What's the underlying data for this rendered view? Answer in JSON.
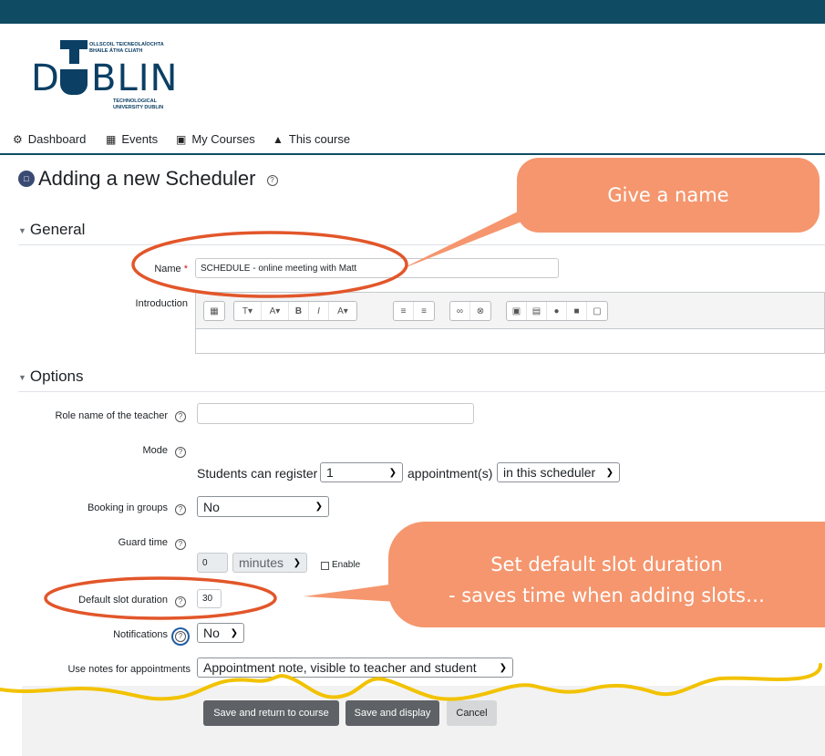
{
  "logo": {
    "irish": "OLLSCOIL TEICNEOLAÍOCHTA\nBHAILE ÁTHA CLIATH",
    "word_d": "D",
    "word_rest": "BLIN",
    "english": "TECHNOLOGICAL\nUNIVERSITY DUBLIN"
  },
  "nav": [
    {
      "label": "Dashboard",
      "icon": "dashboard-icon"
    },
    {
      "label": "Events",
      "icon": "calendar-icon"
    },
    {
      "label": "My Courses",
      "icon": "briefcase-icon"
    },
    {
      "label": "This course",
      "icon": "sitemap-icon"
    }
  ],
  "page": {
    "title": "Adding a new Scheduler"
  },
  "sections": {
    "general": "General",
    "options": "Options"
  },
  "form": {
    "name_label": "Name",
    "required_mark": "*",
    "name_value": "SCHEDULE - online meeting with Matt",
    "intro_label": "Introduction",
    "teacher_label": "Role name of the teacher",
    "teacher_value": "",
    "mode_label": "Mode",
    "mode_prefix": "Students can register",
    "mode_count": "1",
    "mode_mid": "appointment(s)",
    "mode_scope": "in this scheduler",
    "groups_label": "Booking in groups",
    "groups_value": "No",
    "guard_label": "Guard time",
    "guard_value": "0",
    "guard_unit": "minutes",
    "guard_enable": "Enable",
    "duration_label": "Default slot duration",
    "duration_value": "30",
    "notif_label": "Notifications",
    "notif_value": "No",
    "notes_label": "Use notes for appointments",
    "notes_value": "Appointment note, visible to teacher and student"
  },
  "buttons": {
    "save_return": "Save and return to course",
    "save_display": "Save and display",
    "cancel": "Cancel"
  },
  "callouts": {
    "name": "Give a name",
    "duration_line1": "Set default slot duration",
    "duration_line2": "- saves time when adding slots…"
  },
  "colors": {
    "topbar": "#0f4b63",
    "callout": "#f5966e",
    "highlight_ring": "#e2562a",
    "squiggle": "#f2c200"
  }
}
